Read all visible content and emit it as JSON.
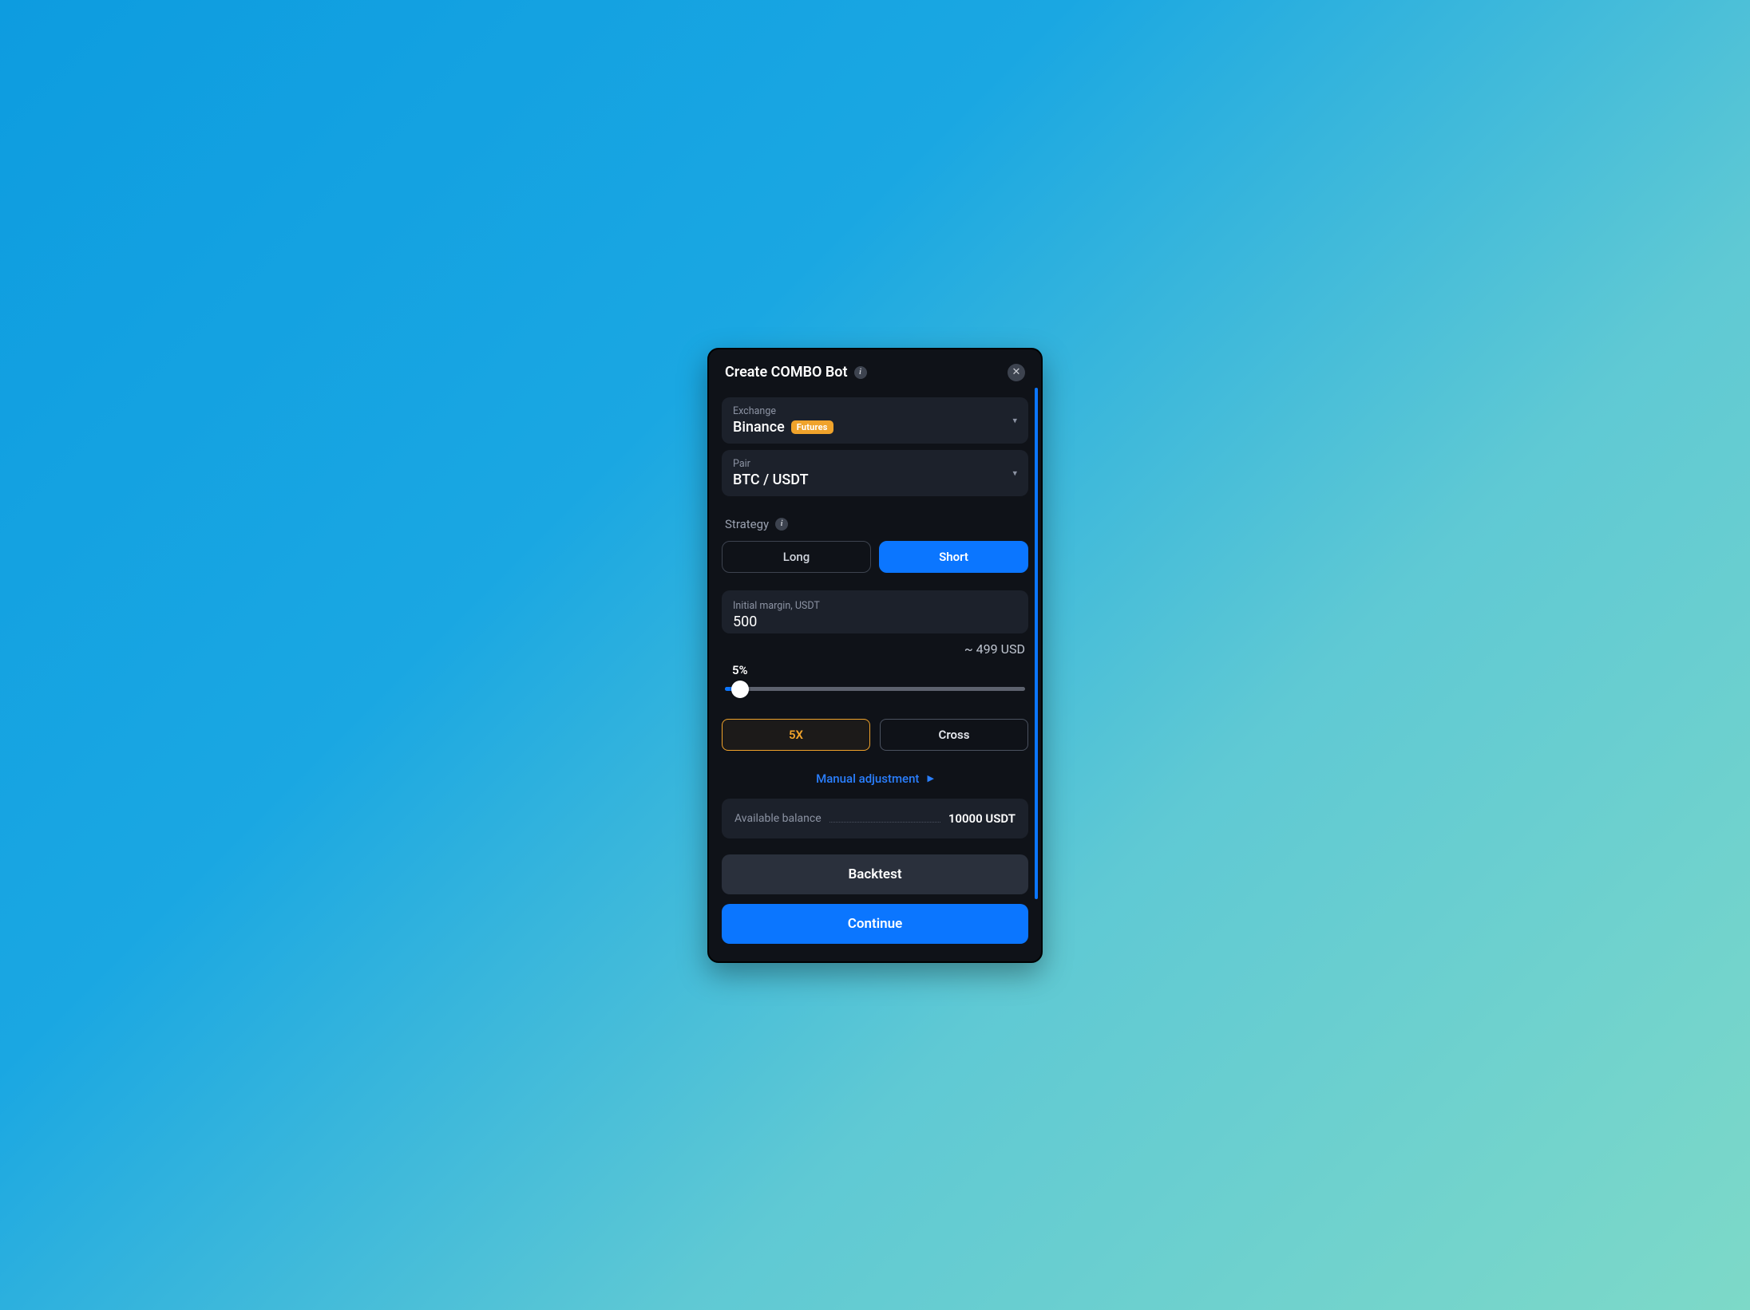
{
  "header": {
    "title": "Create COMBO Bot"
  },
  "exchange": {
    "label": "Exchange",
    "value": "Binance",
    "badge": "Futures"
  },
  "pair": {
    "label": "Pair",
    "value": "BTC / USDT"
  },
  "strategy": {
    "label": "Strategy",
    "options": {
      "long": "Long",
      "short": "Short"
    },
    "active": "short"
  },
  "margin": {
    "label": "Initial margin, USDT",
    "value": "500",
    "approx": "~ 499 USD"
  },
  "slider": {
    "percent": 5,
    "percent_label": "5%"
  },
  "leverage": {
    "multiplier": "5X",
    "mode": "Cross"
  },
  "manual_adjust": "Manual adjustment",
  "balance": {
    "label": "Available balance",
    "value": "10000 USDT"
  },
  "footer": {
    "backtest": "Backtest",
    "continue": "Continue"
  }
}
